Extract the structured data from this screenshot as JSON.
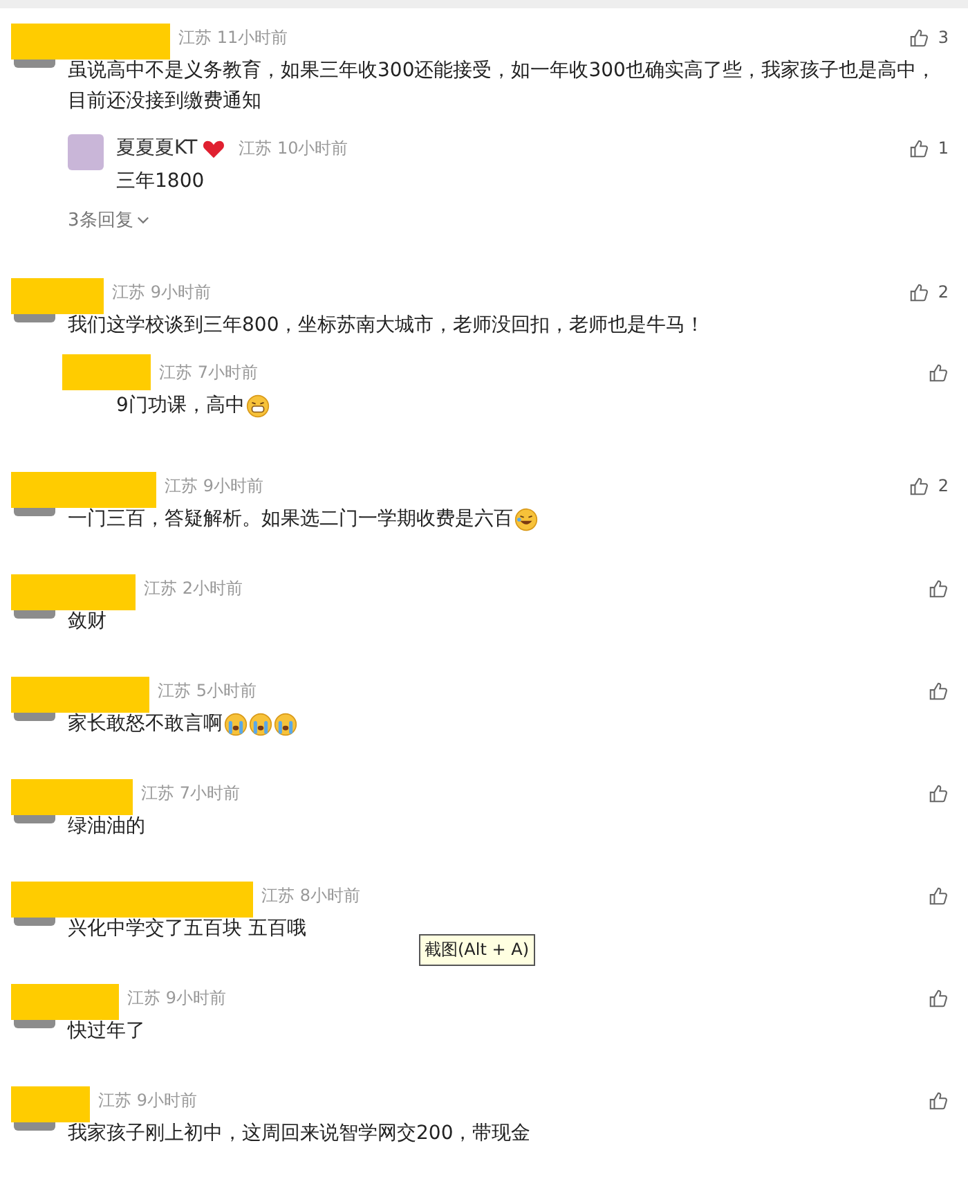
{
  "comments": [
    {
      "author": {
        "redacted": true
      },
      "location": "江苏",
      "time": "11小时前",
      "likes": "3",
      "text": "虽说高中不是义务教育，如果三年收300还能接受，如一年收300也确实高了些，我家孩子也是高中，目前还没接到缴费通知",
      "replies": [
        {
          "author": {
            "redacted": false,
            "name": "夏夏夏KT",
            "heart": true
          },
          "location": "江苏",
          "time": "10小时前",
          "likes": "1",
          "text": "三年1800"
        }
      ],
      "more_replies": "3条回复"
    },
    {
      "author": {
        "redacted": true
      },
      "location": "江苏",
      "time": "9小时前",
      "likes": "2",
      "text": "我们这学校谈到三年800，坐标苏南大城市，老师没回扣，老师也是牛马！",
      "replies": [
        {
          "author": {
            "redacted": true
          },
          "location": "江苏",
          "time": "7小时前",
          "text": "9门功课，高中",
          "emoji": [
            {
              "kind": "grin"
            }
          ]
        }
      ]
    },
    {
      "author": {
        "redacted": true
      },
      "location": "江苏",
      "time": "9小时前",
      "likes": "2",
      "text": "一门三百，答疑解析。如果选二门一学期收费是六百",
      "emoji": [
        {
          "kind": "laugh"
        }
      ]
    },
    {
      "author": {
        "redacted": true
      },
      "location": "江苏",
      "time": "2小时前",
      "text": "敛财"
    },
    {
      "author": {
        "redacted": true
      },
      "location": "江苏",
      "time": "5小时前",
      "text": "家长敢怒不敢言啊",
      "emoji": [
        {
          "kind": "cry"
        },
        {
          "kind": "cry"
        },
        {
          "kind": "cry"
        }
      ]
    },
    {
      "author": {
        "redacted": true
      },
      "location": "江苏",
      "time": "7小时前",
      "text": "绿油油的"
    },
    {
      "author": {
        "redacted": true
      },
      "location": "江苏",
      "time": "8小时前",
      "text": "兴化中学交了五百块 五百哦"
    },
    {
      "author": {
        "redacted": true
      },
      "location": "江苏",
      "time": "9小时前",
      "text": "快过年了"
    },
    {
      "author": {
        "redacted": true
      },
      "location": "江苏",
      "time": "9小时前",
      "text": "我家孩子刚上初中，这周回来说智学网交200，带现金"
    }
  ],
  "tooltip": {
    "text": "截图(Alt + A)"
  }
}
